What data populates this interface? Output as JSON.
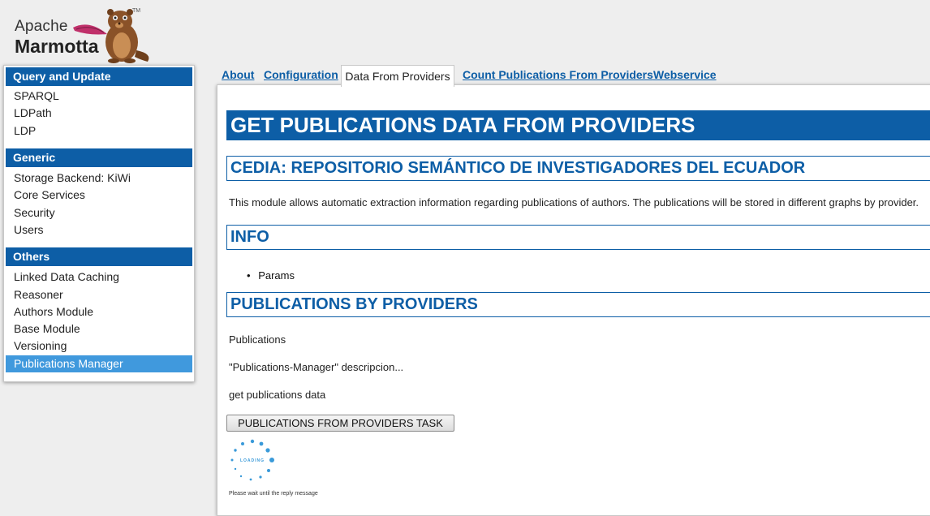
{
  "logo": {
    "line1": "Apache",
    "line2": "Marmotta",
    "tm": "TM"
  },
  "sidebar": {
    "sections": [
      {
        "title": "Query and Update",
        "items": [
          "SPARQL",
          "LDPath",
          "LDP"
        ]
      },
      {
        "title": "Generic",
        "items": [
          "Storage Backend: KiWi",
          "Core Services",
          "Security",
          "Users"
        ]
      },
      {
        "title": "Others",
        "items": [
          "Linked Data Caching",
          "Reasoner",
          "Authors Module",
          "Base Module",
          "Versioning",
          "Publications Manager"
        ]
      }
    ],
    "active_item": "Publications Manager"
  },
  "tabs": [
    "About",
    "Configuration",
    "Data From Providers",
    "Count Publications From Providers",
    "Webservice"
  ],
  "active_tab": "Data From Providers",
  "page": {
    "title": "GET PUBLICATIONS DATA FROM PROVIDERS",
    "subtitle": "CEDIA: REPOSITORIO SEMÁNTICO DE INVESTIGADORES DEL ECUADOR",
    "description": "This module allows automatic extraction information regarding publications of authors. The publications will be stored in different graphs by provider.",
    "info_heading": "INFO",
    "info_items": [
      "Params"
    ],
    "providers_heading": "PUBLICATIONS BY PROVIDERS",
    "publications_label": "Publications",
    "manager_description": "\"Publications-Manager\" descripcion...",
    "get_data_label": "get publications data",
    "task_button": "PUBLICATIONS FROM PROVIDERS TASK",
    "loading_text": "LOADING",
    "wait_message": "Please wait until the reply message"
  },
  "colors": {
    "primary": "#0d5ea6",
    "active_item": "#4099dd",
    "loader": "#3a9ad9"
  },
  "icons": {
    "mascot": "marmot-mascot",
    "loader": "loading-spinner-icon"
  }
}
